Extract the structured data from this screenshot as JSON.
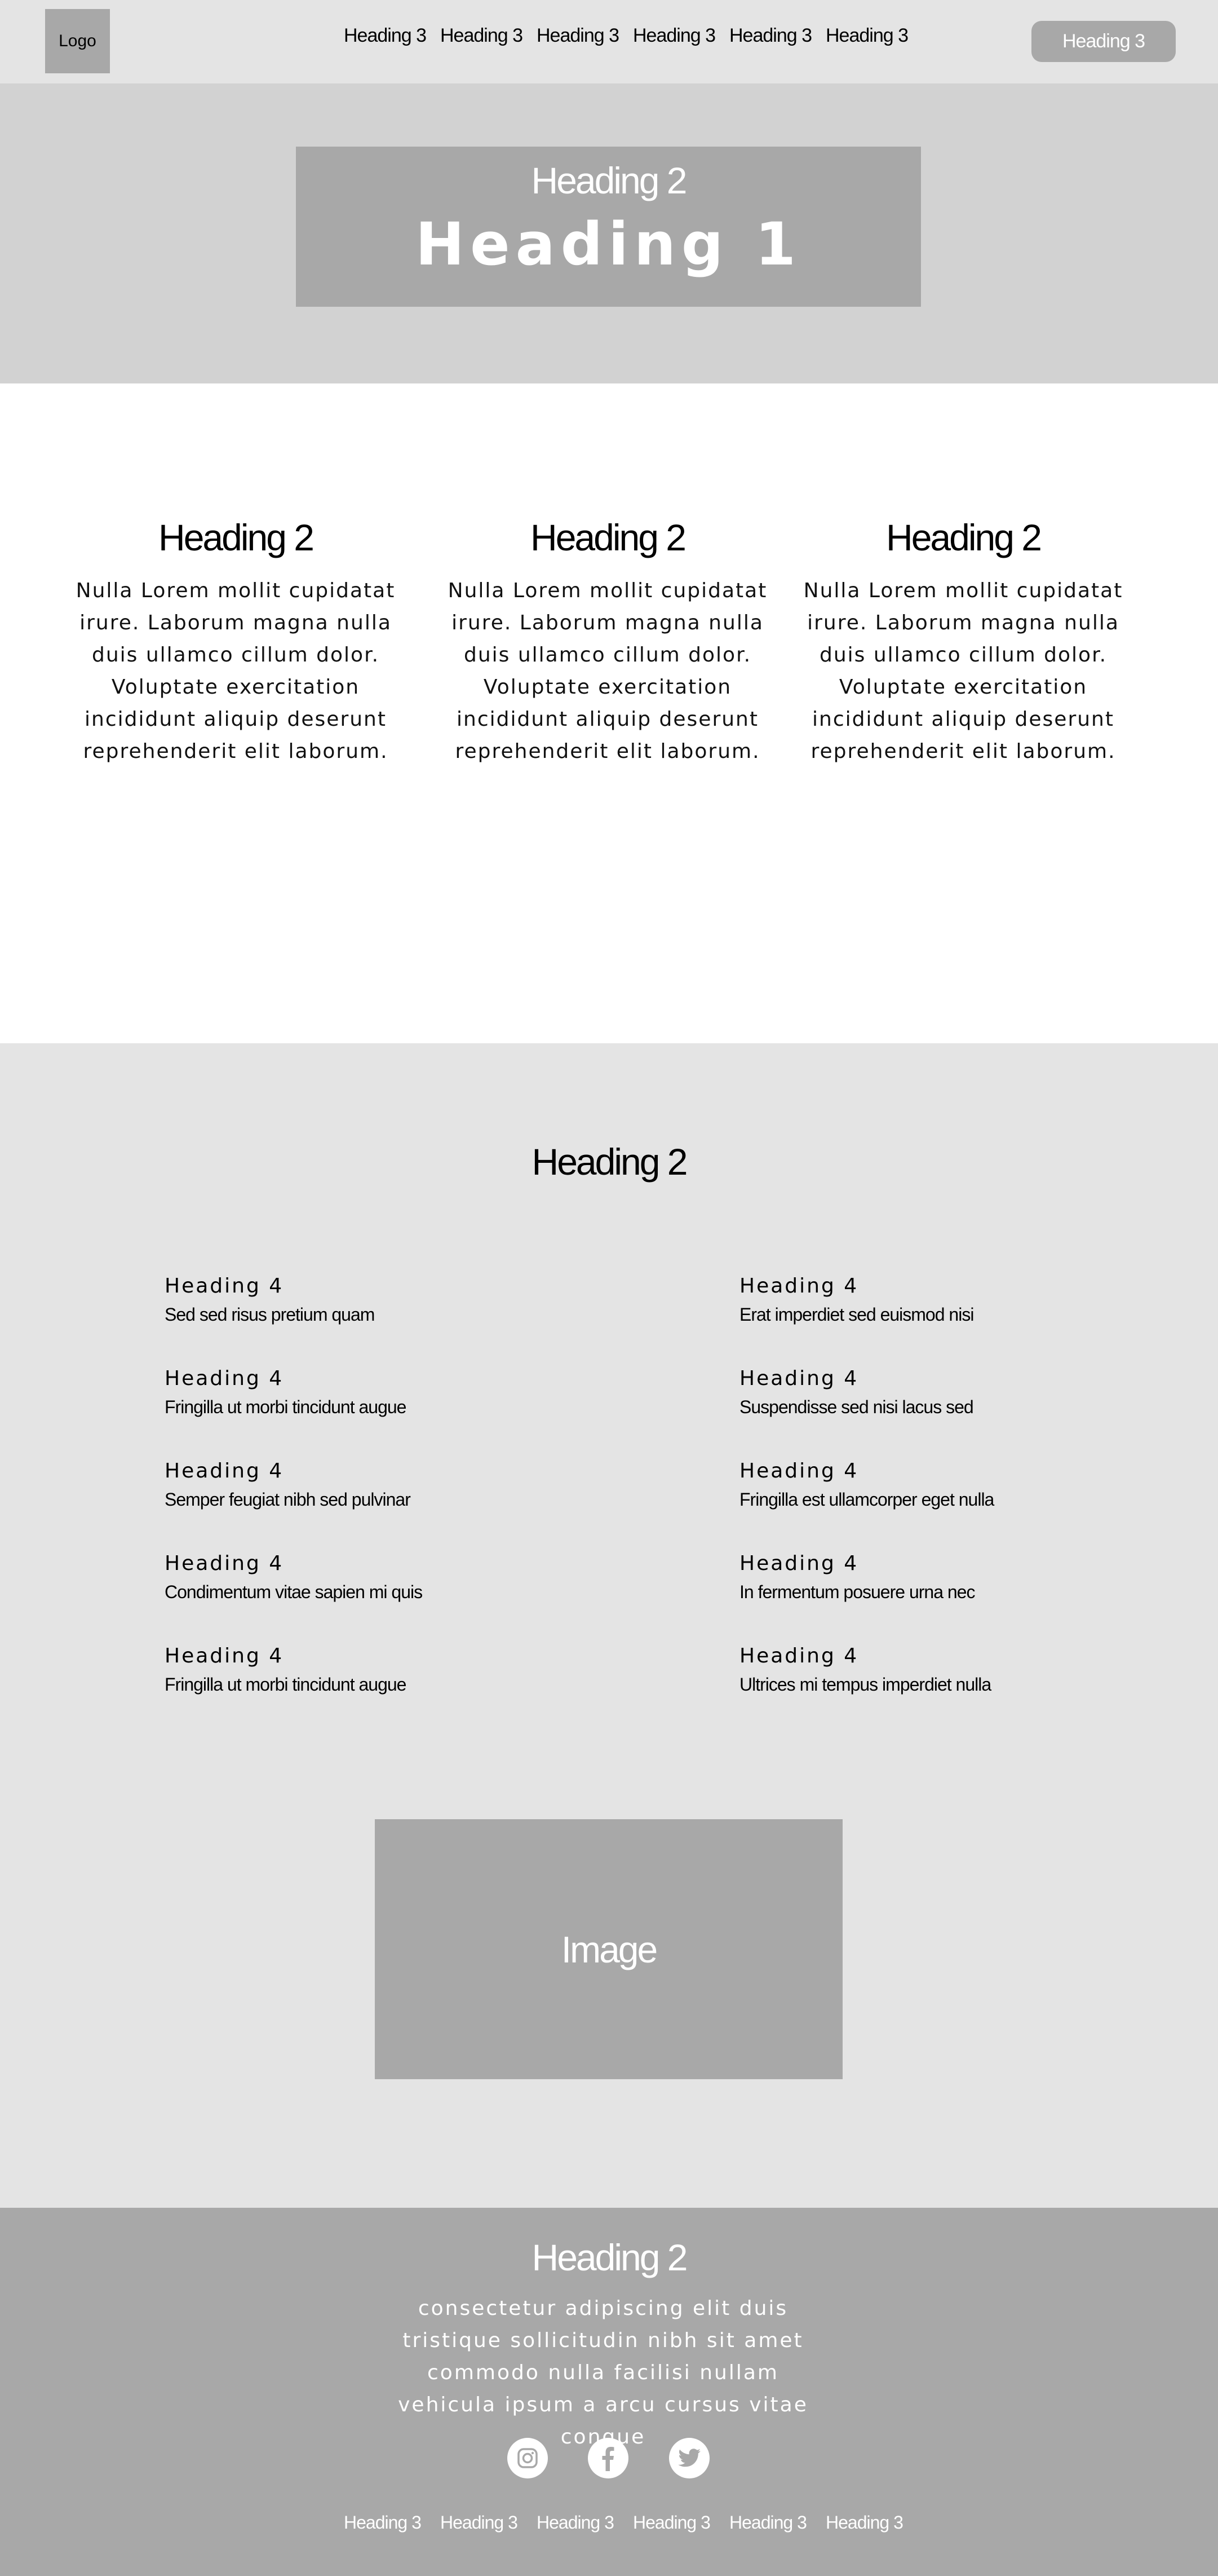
{
  "header": {
    "logo": "Logo",
    "nav": [
      "Heading 3",
      "Heading 3",
      "Heading 3",
      "Heading 3",
      "Heading 3",
      "Heading 3"
    ],
    "cta": "Heading 3"
  },
  "hero": {
    "subtitle": "Heading 2",
    "title": "Heading 1"
  },
  "features": [
    {
      "title": "Heading 2",
      "text": "Nulla Lorem mollit cupidatat irure. Laborum magna nulla duis ullamco cillum dolor. Voluptate exercitation incididunt aliquip deserunt reprehenderit elit laborum."
    },
    {
      "title": "Heading 2",
      "text": "Nulla Lorem mollit cupidatat irure. Laborum magna nulla duis ullamco cillum dolor. Voluptate exercitation incididunt aliquip deserunt reprehenderit elit laborum."
    },
    {
      "title": "Heading 2",
      "text": "Nulla Lorem mollit cupidatat irure. Laborum magna nulla duis ullamco cillum dolor. Voluptate exercitation incididunt aliquip deserunt reprehenderit elit laborum."
    }
  ],
  "list_section": {
    "title": "Heading 2",
    "left": [
      {
        "heading": "Heading 4",
        "text": "Sed sed risus pretium quam"
      },
      {
        "heading": "Heading 4",
        "text": "Fringilla ut morbi tincidunt augue"
      },
      {
        "heading": "Heading 4",
        "text": "Semper feugiat nibh sed pulvinar"
      },
      {
        "heading": "Heading 4",
        "text": "Condimentum vitae sapien mi quis"
      },
      {
        "heading": "Heading 4",
        "text": "Fringilla ut morbi tincidunt augue"
      }
    ],
    "right": [
      {
        "heading": "Heading 4",
        "text": "Erat imperdiet sed euismod nisi"
      },
      {
        "heading": "Heading 4",
        "text": "Suspendisse sed nisi lacus sed"
      },
      {
        "heading": "Heading 4",
        "text": "Fringilla est ullamcorper eget nulla"
      },
      {
        "heading": "Heading 4",
        "text": "In fermentum posuere urna nec"
      },
      {
        "heading": "Heading 4",
        "text": "Ultrices mi tempus imperdiet nulla"
      }
    ],
    "image_label": "Image"
  },
  "footer": {
    "title": "Heading 2",
    "text": "consectetur adipiscing elit duis tristique sollicitudin nibh sit amet commodo nulla facilisi nullam vehicula ipsum a arcu cursus vitae congue",
    "socials": [
      "instagram-icon",
      "facebook-icon",
      "twitter-icon"
    ],
    "nav": [
      "Heading 3",
      "Heading 3",
      "Heading 3",
      "Heading 3",
      "Heading 3",
      "Heading 3"
    ]
  },
  "colors": {
    "header_bg": "#e4e4e4",
    "hero_bg": "#d2d2d2",
    "placeholder_gray": "#a8a8a8",
    "section_bg": "#e4e4e4",
    "text_light": "#ffffff"
  }
}
